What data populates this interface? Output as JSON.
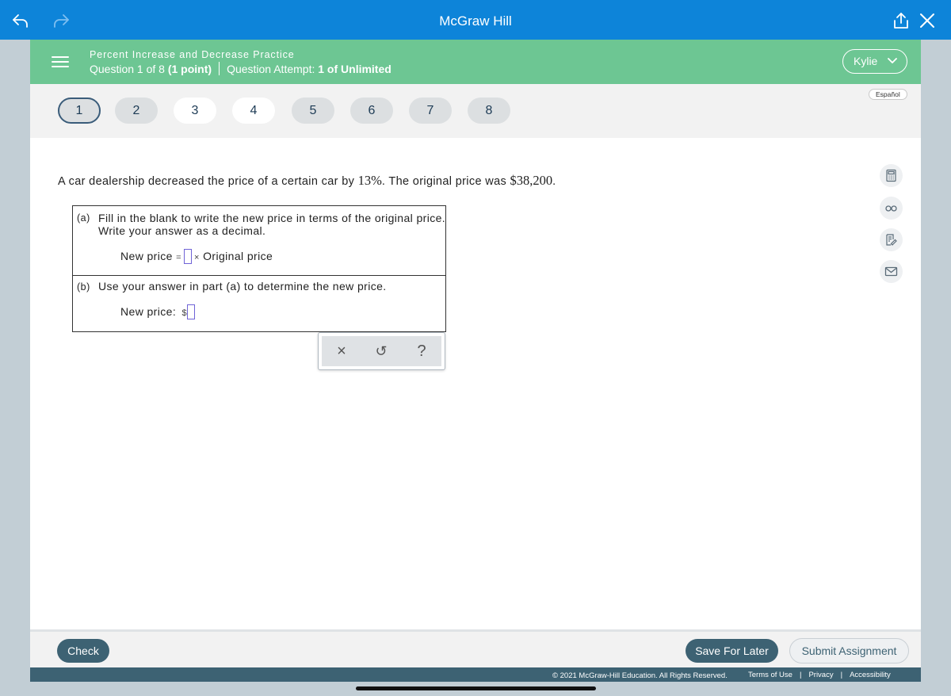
{
  "topbar": {
    "title": "McGraw Hill",
    "icons": [
      "back-arrow-icon",
      "forward-arrow-icon",
      "share-icon",
      "close-icon"
    ]
  },
  "header": {
    "assignment_title": "Percent Increase and Decrease Practice",
    "question_prefix": "Question 1 of 8",
    "points": "(1 point)",
    "attempt_label": "Question Attempt:",
    "attempt_value": "1 of Unlimited",
    "user_name": "Kylie",
    "accent_color": "#6dc693"
  },
  "question_nav": {
    "items": [
      "1",
      "2",
      "3",
      "4",
      "5",
      "6",
      "7",
      "8"
    ],
    "current": "1",
    "language_button": "Español"
  },
  "question": {
    "text_1": "A car dealership decreased the price of a certain car by ",
    "percent": "13%",
    "text_2": ". The original price was ",
    "price": "$38,200",
    "text_3": ".",
    "part_a": {
      "label": "(a)",
      "line1": "Fill in the blank to write the new price in terms of the original price.",
      "line2": "Write your answer as a decimal.",
      "eq_left": "New price",
      "eq_equals": "=",
      "eq_times": "×",
      "eq_right": "Original price",
      "answer_value": ""
    },
    "part_b": {
      "label": "(b)",
      "text": "Use your answer in part (a) to determine the new price.",
      "eq_left": "New price:",
      "currency": "$",
      "answer_value": ""
    }
  },
  "answer_tools": {
    "clear": "×",
    "undo": "↺",
    "help": "?"
  },
  "side_tools": [
    "calculator-icon",
    "glasses-icon",
    "notes-icon",
    "mail-icon"
  ],
  "footer": {
    "check_label": "Check",
    "save_label": "Save For Later",
    "submit_label": "Submit Assignment",
    "copyright": "© 2021 McGraw-Hill Education. All Rights Reserved.",
    "links": [
      "Terms of Use",
      "Privacy",
      "Accessibility"
    ],
    "separator": "|"
  },
  "colors": {
    "topbar": "#0d84d9",
    "header": "#6dc693",
    "footer_bar": "#3d6273",
    "button": "#3d6273",
    "answer_box_border": "#6f63d6"
  }
}
